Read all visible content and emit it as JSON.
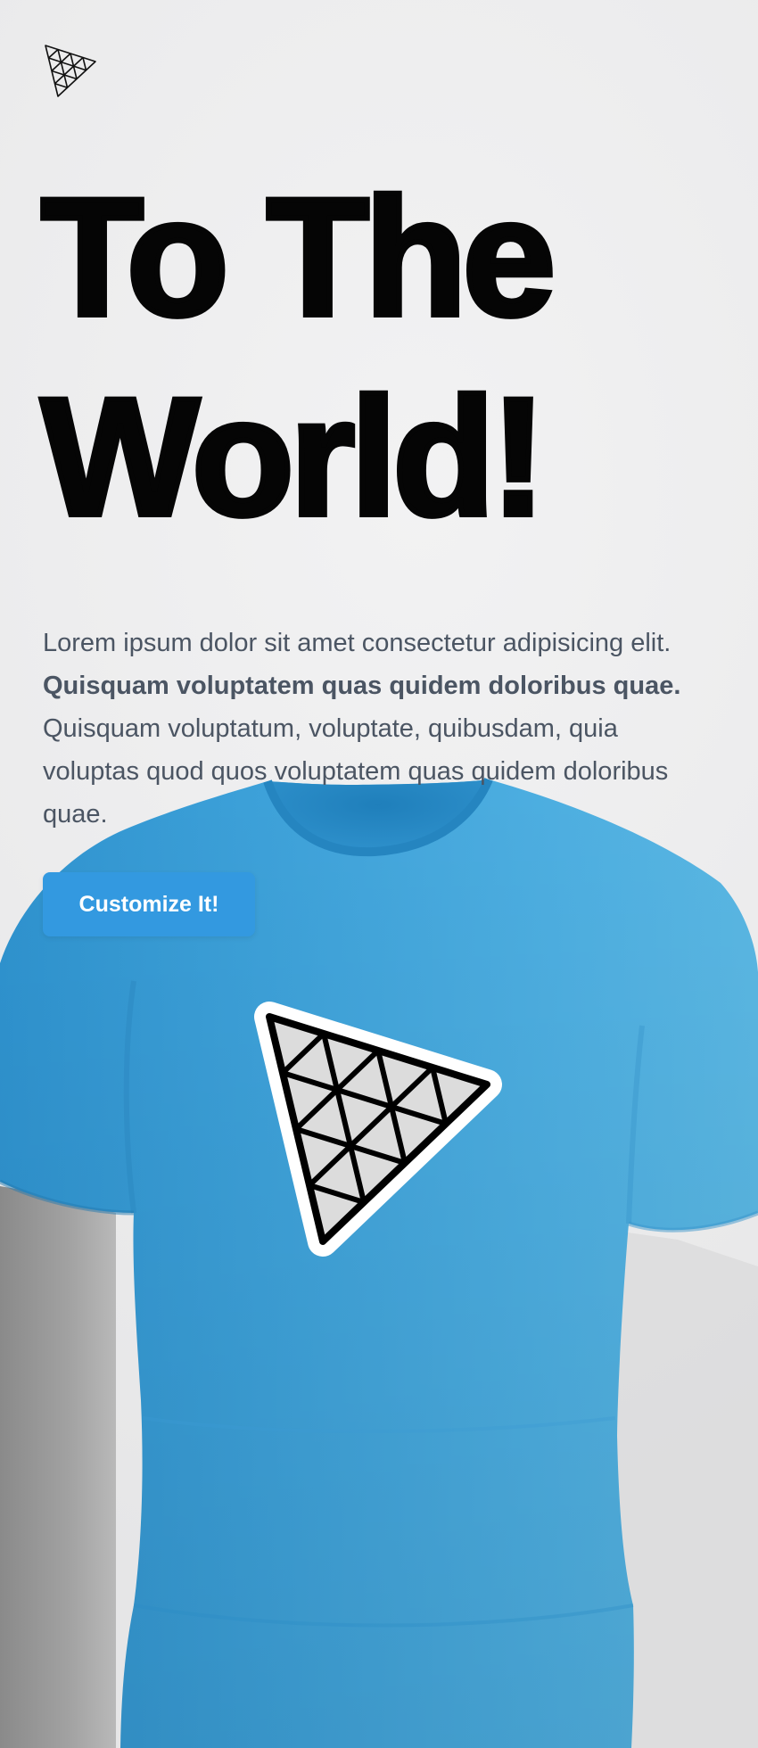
{
  "brand": {
    "logo_icon": "triangle-grid-logo-icon"
  },
  "hero": {
    "headline_line1": "To The",
    "headline_line2": "World!",
    "intro_part1": "Lorem ipsum dolor sit amet consectetur adipisicing elit. ",
    "intro_bold": "Quisquam voluptatem quas quidem doloribus quae.",
    "intro_part2": " Quisquam voluptatum, voluptate, quibusdam, quia voluptas quod quos voluptatem quas quidem doloribus quae.",
    "cta_label": "Customize It!"
  },
  "shirt": {
    "color": "#4aa9dc",
    "decal_icon": "triangle-grid-decal-icon"
  },
  "colors": {
    "accent": "#3399e0",
    "headline": "#050505",
    "body_text": "#4b5563",
    "background": "#ececed"
  }
}
